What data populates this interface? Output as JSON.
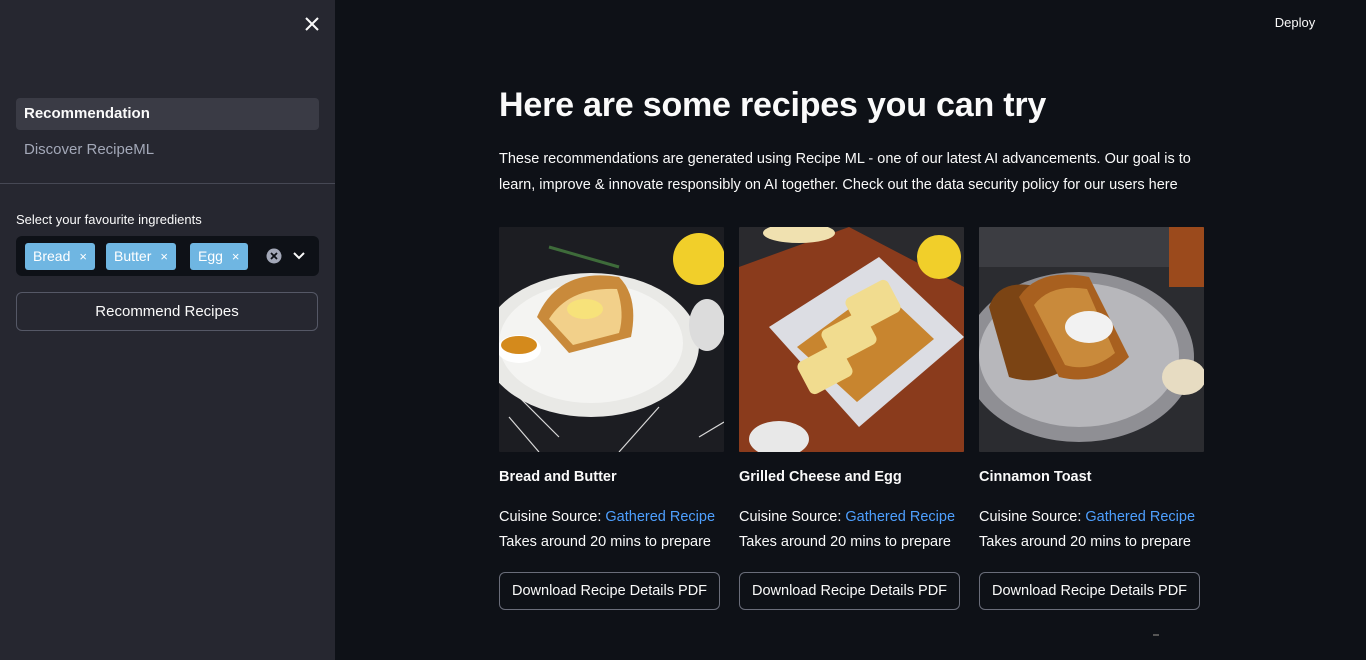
{
  "sidebar": {
    "nav": [
      {
        "label": "Recommendation",
        "active": true
      },
      {
        "label": "Discover RecipeML",
        "active": false
      }
    ],
    "ingredients_label": "Select your favourite ingredients",
    "selected_ingredients": [
      "Bread",
      "Butter",
      "Egg"
    ],
    "tag_remove_glyph": "×",
    "recommend_button": "Recommend Recipes",
    "icons": [
      "close-icon",
      "clear-all-icon",
      "chevron-down-icon"
    ]
  },
  "header": {
    "deploy_label": "Deploy"
  },
  "main": {
    "title": "Here are some recipes you can try",
    "intro": "These recommendations are generated using Recipe ML - one of our latest AI advancements. Our goal is to learn, improve & innovate responsibly on AI together. Check out the data security policy for our users here",
    "recipes": [
      {
        "title": "Bread and Butter",
        "source_prefix": "Cuisine Source: ",
        "source_link": "Gathered Recipe",
        "time": "Takes around 20 mins to prepare",
        "download": "Download Recipe Details PDF"
      },
      {
        "title": "Grilled Cheese and Egg",
        "source_prefix": "Cuisine Source: ",
        "source_link": "Gathered Recipe",
        "time": "Takes around 20 mins to prepare",
        "download": "Download Recipe Details PDF"
      },
      {
        "title": "Cinnamon Toast",
        "source_prefix": "Cuisine Source: ",
        "source_link": "Gathered Recipe",
        "time": "Takes around 20 mins to prepare",
        "download": "Download Recipe Details PDF"
      }
    ]
  },
  "colors": {
    "background": "#0e1117",
    "sidebar": "#262730",
    "tag": "#6fb6e2",
    "link": "#4ea0ff"
  }
}
